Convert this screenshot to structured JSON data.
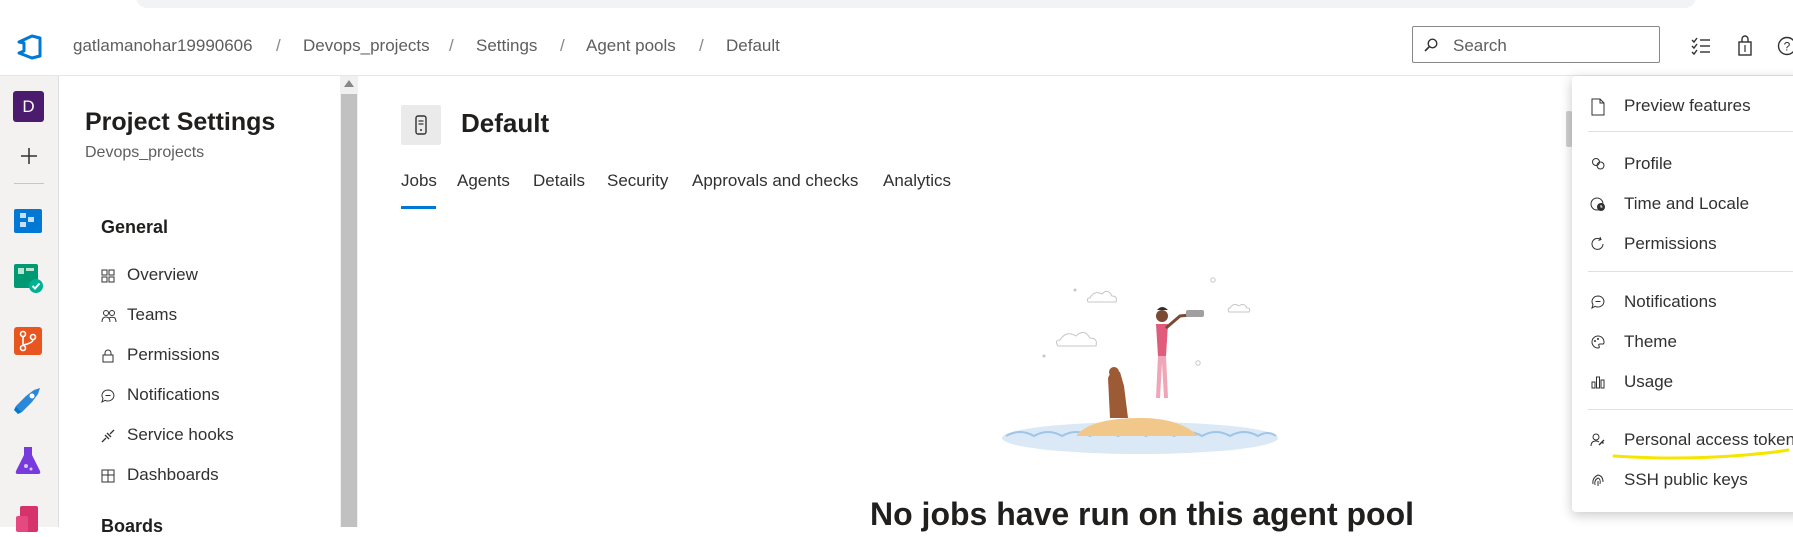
{
  "header": {
    "breadcrumbs": [
      "gatlamanohar19990606",
      "Devops_projects",
      "Settings",
      "Agent pools",
      "Default"
    ],
    "separator": "/",
    "search_placeholder": "Search"
  },
  "rail": {
    "org_initial": "D",
    "apps": [
      "boards-icon",
      "test-plans-check-icon",
      "repos-icon",
      "pipelines-icon",
      "artifacts-flask-icon",
      "extra-app-icon"
    ]
  },
  "sidebar": {
    "title": "Project Settings",
    "subtitle": "Devops_projects",
    "section_general": "General",
    "items": [
      {
        "label": "Overview",
        "icon": "overview-icon"
      },
      {
        "label": "Teams",
        "icon": "teams-icon"
      },
      {
        "label": "Permissions",
        "icon": "lock-icon"
      },
      {
        "label": "Notifications",
        "icon": "chat-bubble-icon"
      },
      {
        "label": "Service hooks",
        "icon": "hook-icon"
      },
      {
        "label": "Dashboards",
        "icon": "dashboard-icon"
      }
    ],
    "section_boards": "Boards"
  },
  "main": {
    "title": "Default",
    "tabs": [
      "Jobs",
      "Agents",
      "Details",
      "Security",
      "Approvals and checks",
      "Analytics"
    ],
    "active_tab": "Jobs",
    "empty_message": "No jobs have run on this agent pool"
  },
  "menu": {
    "items": [
      {
        "label": "Preview features",
        "icon": "document-icon"
      },
      {
        "label": "Profile",
        "icon": "profile-icon"
      },
      {
        "label": "Time and Locale",
        "icon": "clock-globe-icon"
      },
      {
        "label": "Permissions",
        "icon": "refresh-icon"
      },
      {
        "label": "Notifications",
        "icon": "chat-bubble-icon"
      },
      {
        "label": "Theme",
        "icon": "palette-icon"
      },
      {
        "label": "Usage",
        "icon": "chart-icon"
      },
      {
        "label": "Personal access tokens",
        "icon": "key-person-icon"
      },
      {
        "label": "SSH public keys",
        "icon": "fingerprint-icon"
      }
    ]
  },
  "colors": {
    "accent": "#0078d4",
    "org_avatar": "#4b1b6e",
    "highlight": "#f5e600"
  }
}
